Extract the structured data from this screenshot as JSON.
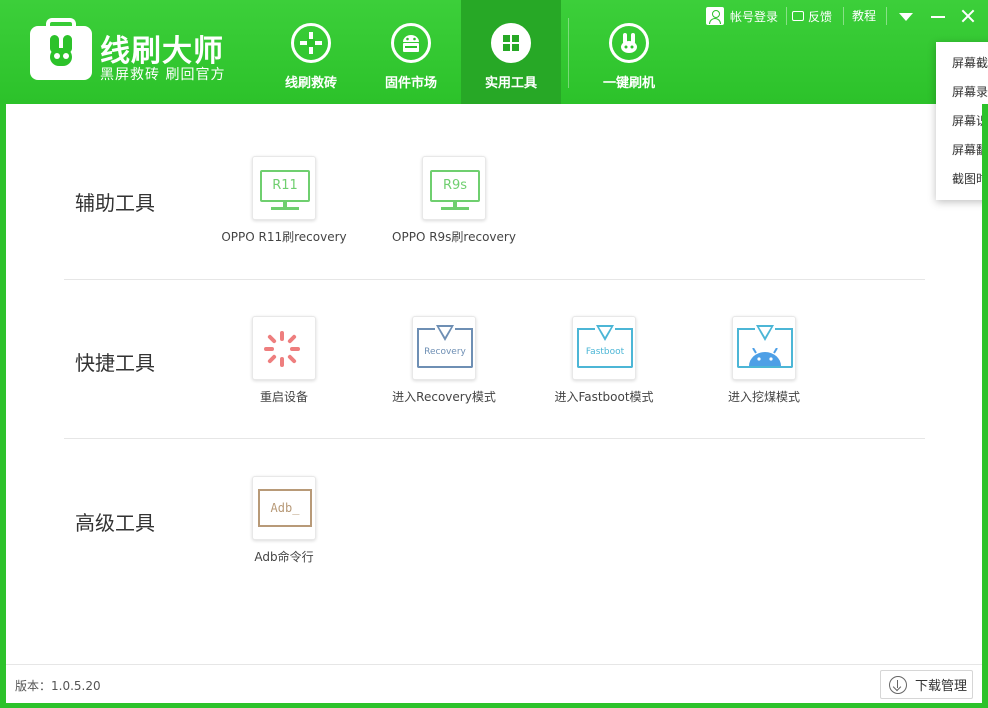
{
  "brand": {
    "name": "线刷大师",
    "slogan": "黑屏救砖 刷回官方"
  },
  "nav": {
    "tabs": [
      {
        "label": "线刷救砖",
        "icon": "cross-move-icon",
        "active": false
      },
      {
        "label": "固件市场",
        "icon": "android-icon",
        "active": false
      },
      {
        "label": "实用工具",
        "icon": "windows-grid-icon",
        "active": true
      },
      {
        "label": "一键刷机",
        "icon": "rabbit-icon",
        "active": false
      }
    ]
  },
  "titlebar": {
    "login": "帐号登录",
    "feedback": "反馈",
    "tutorial": "教程"
  },
  "dropdown": {
    "items": [
      "屏幕截",
      "屏幕录",
      "屏幕识",
      "屏幕翻",
      "截图时"
    ]
  },
  "sections": [
    {
      "title": "辅助工具",
      "tools": [
        {
          "label": "OPPO R11刷recovery",
          "icon_text": "R11"
        },
        {
          "label": "OPPO R9s刷recovery",
          "icon_text": "R9s"
        }
      ]
    },
    {
      "title": "快捷工具",
      "tools": [
        {
          "label": "重启设备"
        },
        {
          "label": "进入Recovery模式",
          "icon_text": "Recovery"
        },
        {
          "label": "进入Fastboot模式",
          "icon_text": "Fastboot"
        },
        {
          "label": "进入挖煤模式"
        }
      ]
    },
    {
      "title": "高级工具",
      "tools": [
        {
          "label": "Adb命令行",
          "icon_text": "Adb_"
        }
      ]
    }
  ],
  "footer": {
    "version": "版本：1.0.5.20",
    "download": "下载管理"
  },
  "colors": {
    "header_green": "#2cc22a",
    "active_tab": "#27a826",
    "monitor_green": "#6fcf6f",
    "restart_red": "#ee7e7e",
    "recovery_blue": "#6e8fb4",
    "fastboot_cyan": "#4cb6d6",
    "adb_brown": "#b89a78"
  }
}
